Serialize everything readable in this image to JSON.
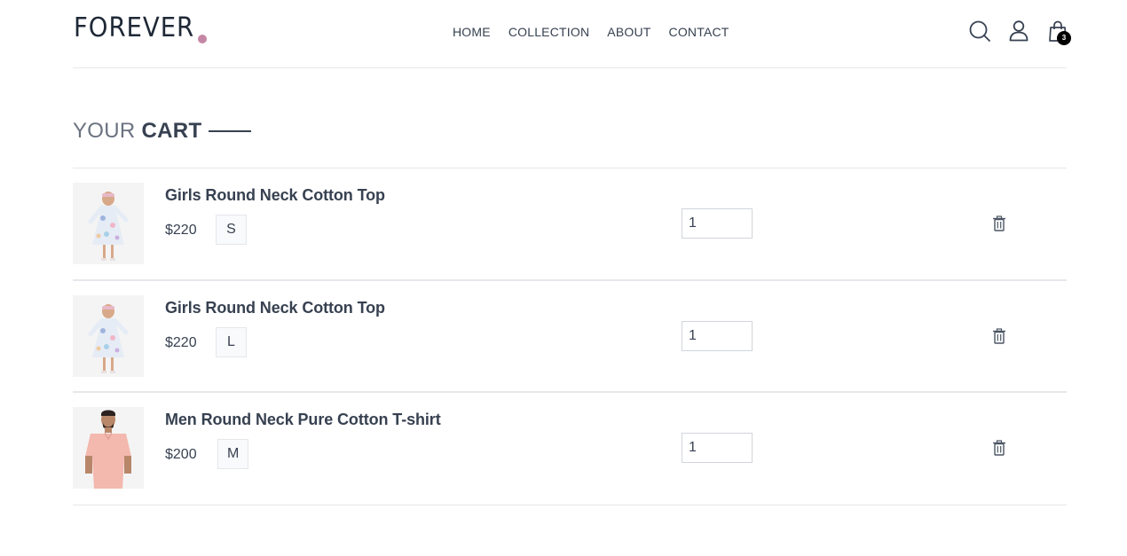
{
  "brand": {
    "logo_text": "FOREVER",
    "accent_color": "#c586a5"
  },
  "nav": {
    "items": [
      {
        "label": "HOME"
      },
      {
        "label": "COLLECTION"
      },
      {
        "label": "ABOUT"
      },
      {
        "label": "CONTACT"
      }
    ]
  },
  "header_icons": {
    "search": "search-icon",
    "profile": "user-icon",
    "cart": "shopping-bag-icon",
    "cart_count": "3"
  },
  "page_title": {
    "light": "YOUR",
    "bold": "CART"
  },
  "cart": {
    "items": [
      {
        "name": "Girls Round Neck Cotton Top",
        "price": "$220",
        "size": "S",
        "quantity": "1",
        "image": "girl-floral-dress-photo"
      },
      {
        "name": "Girls Round Neck Cotton Top",
        "price": "$220",
        "size": "L",
        "quantity": "1",
        "image": "girl-floral-dress-photo"
      },
      {
        "name": "Men Round Neck Pure Cotton T-shirt",
        "price": "$200",
        "size": "M",
        "quantity": "1",
        "image": "man-pink-shirt-photo"
      }
    ]
  }
}
